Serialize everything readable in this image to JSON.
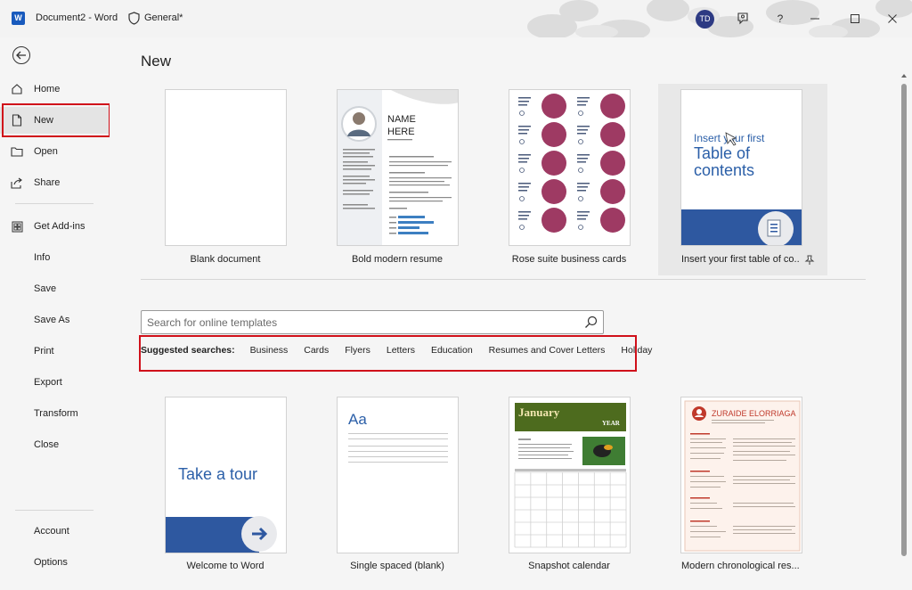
{
  "titlebar": {
    "doc_title": "Document2  -  Word",
    "sensitivity": "General*",
    "avatar_initials": "TD",
    "app_logo_letter": "W",
    "help": "?"
  },
  "sidebar": {
    "items": [
      {
        "label": "Home",
        "icon": "home-icon"
      },
      {
        "label": "New",
        "icon": "new-document-icon"
      },
      {
        "label": "Open",
        "icon": "folder-icon"
      },
      {
        "label": "Share",
        "icon": "share-icon"
      },
      {
        "label": "Get Add-ins",
        "icon": "grid-icon"
      },
      {
        "label": "Info"
      },
      {
        "label": "Save"
      },
      {
        "label": "Save As"
      },
      {
        "label": "Print"
      },
      {
        "label": "Export"
      },
      {
        "label": "Transform"
      },
      {
        "label": "Close"
      },
      {
        "label": "Account"
      },
      {
        "label": "Options"
      }
    ]
  },
  "main": {
    "title": "New",
    "templates_top": [
      {
        "label": "Blank document"
      },
      {
        "label": "Bold modern resume",
        "thumb_name": "NAME",
        "thumb_name2": "HERE"
      },
      {
        "label": "Rose suite business cards"
      },
      {
        "label": "Insert your first table of co...",
        "thumb_line1": "Insert your first",
        "thumb_line2": "Table of",
        "thumb_line3": "contents"
      }
    ],
    "search": {
      "placeholder": "Search for online templates",
      "value": ""
    },
    "suggested": {
      "lead": "Suggested searches:",
      "items": [
        "Business",
        "Cards",
        "Flyers",
        "Letters",
        "Education",
        "Resumes and Cover Letters",
        "Holiday"
      ]
    },
    "templates_bottom": [
      {
        "label": "Welcome to Word",
        "thumb_text": "Take a tour"
      },
      {
        "label": "Single spaced (blank)",
        "thumb_text": "Aa"
      },
      {
        "label": "Snapshot calendar",
        "thumb_month": "January",
        "thumb_year": "YEAR"
      },
      {
        "label": "Modern chronological res...",
        "thumb_name": "ZURAIDE ELORRIAGA"
      }
    ]
  },
  "colors": {
    "accent": "#185abd",
    "highlight_red": "#d0101a",
    "rose": "#9e3a63",
    "calendar_green": "#4d6b1e"
  }
}
